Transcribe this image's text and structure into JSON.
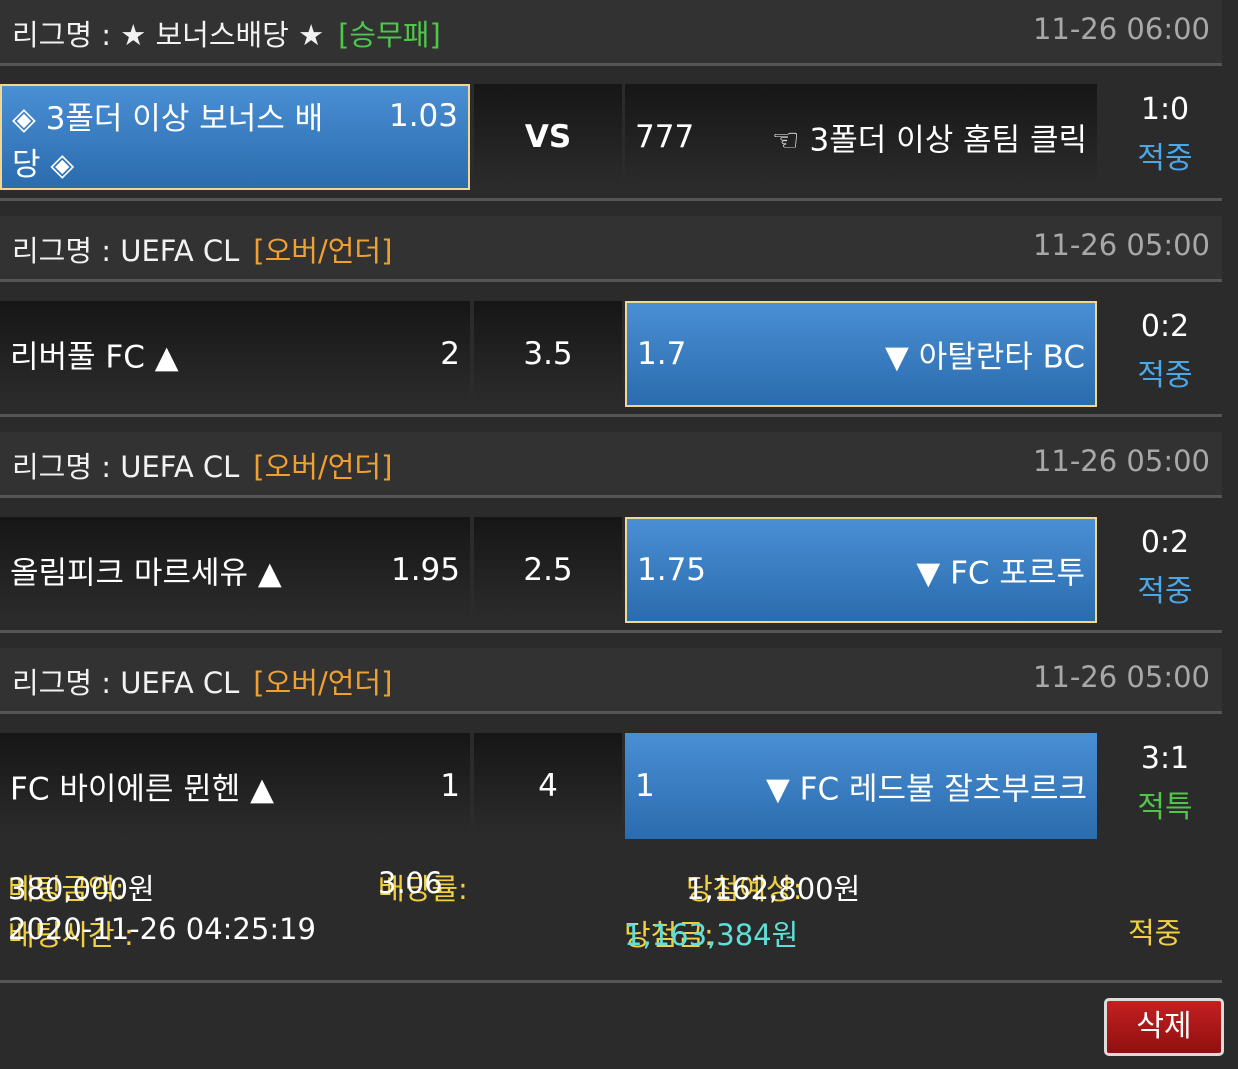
{
  "games": [
    {
      "league_label": "리그명 : ★ 보너스배당 ★",
      "bet_type": "[승무패]",
      "time": "11-26 06:00",
      "home": "◈ 3폴더 이상 보너스 배당 ◈",
      "home_odd": "1.03",
      "mid": "VS",
      "away_odd": "777",
      "away": "☜ 3폴더 이상 홈팀 클릭",
      "score": "1:0",
      "status": "적중"
    },
    {
      "league_label": "리그명 : UEFA CL",
      "bet_type": "[오버/언더]",
      "time": "11-26 05:00",
      "home": "리버풀 FC ▲",
      "home_odd": "2",
      "mid": "3.5",
      "away_odd": "1.7",
      "away": "▼ 아탈란타 BC",
      "score": "0:2",
      "status": "적중"
    },
    {
      "league_label": "리그명 : UEFA CL",
      "bet_type": "[오버/언더]",
      "time": "11-26 05:00",
      "home": "올림피크 마르세유 ▲",
      "home_odd": "1.95",
      "mid": "2.5",
      "away_odd": "1.75",
      "away": "▼ FC 포르투",
      "score": "0:2",
      "status": "적중"
    },
    {
      "league_label": "리그명 : UEFA CL",
      "bet_type": "[오버/언더]",
      "time": "11-26 05:00",
      "home": "FC 바이에른 뮌헨 ▲",
      "home_odd": "1",
      "mid": "4",
      "away_odd": "1",
      "away": "▼ FC 레드불 잘츠부르크",
      "score": "3:1",
      "status": "적특"
    }
  ],
  "summary": {
    "bet_amount_label": "베팅금액:",
    "bet_amount": "380,000원",
    "odds_label": "배당률:",
    "odds": "3.06",
    "expected_label": "당첨예상:",
    "expected": "1,162,800원",
    "bet_time_label": "배팅시간 :",
    "bet_time": "2020-11-26 04:25:19",
    "win_label": "당첨금:",
    "win": "1,163,384원",
    "result": "적중"
  },
  "delete_label": "삭제"
}
